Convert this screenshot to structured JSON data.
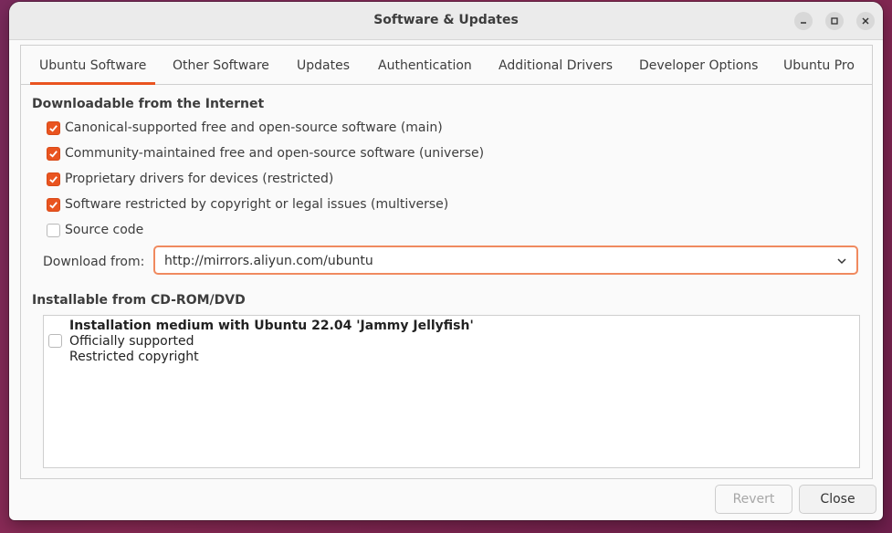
{
  "window": {
    "title": "Software & Updates"
  },
  "tabs": [
    {
      "label": "Ubuntu Software",
      "active": true
    },
    {
      "label": "Other Software",
      "active": false
    },
    {
      "label": "Updates",
      "active": false
    },
    {
      "label": "Authentication",
      "active": false
    },
    {
      "label": "Additional Drivers",
      "active": false
    },
    {
      "label": "Developer Options",
      "active": false
    },
    {
      "label": "Ubuntu Pro",
      "active": false
    }
  ],
  "internet": {
    "heading": "Downloadable from the Internet",
    "options": [
      {
        "label": "Canonical-supported free and open-source software (main)",
        "checked": true
      },
      {
        "label": "Community-maintained free and open-source software (universe)",
        "checked": true
      },
      {
        "label": "Proprietary drivers for devices (restricted)",
        "checked": true
      },
      {
        "label": "Software restricted by copyright or legal issues (multiverse)",
        "checked": true
      },
      {
        "label": "Source code",
        "checked": false
      }
    ],
    "download_from_label": "Download from:",
    "download_from_value": "http://mirrors.aliyun.com/ubuntu"
  },
  "cdrom": {
    "heading": "Installable from CD-ROM/DVD",
    "item": {
      "name": "Installation medium with Ubuntu 22.04 'Jammy Jellyfish'",
      "line2": "Officially supported",
      "line3": "Restricted copyright",
      "checked": false
    }
  },
  "buttons": {
    "revert": "Revert",
    "close": "Close"
  },
  "colors": {
    "accent": "#e95420",
    "desktop": "#7a2a5c"
  }
}
